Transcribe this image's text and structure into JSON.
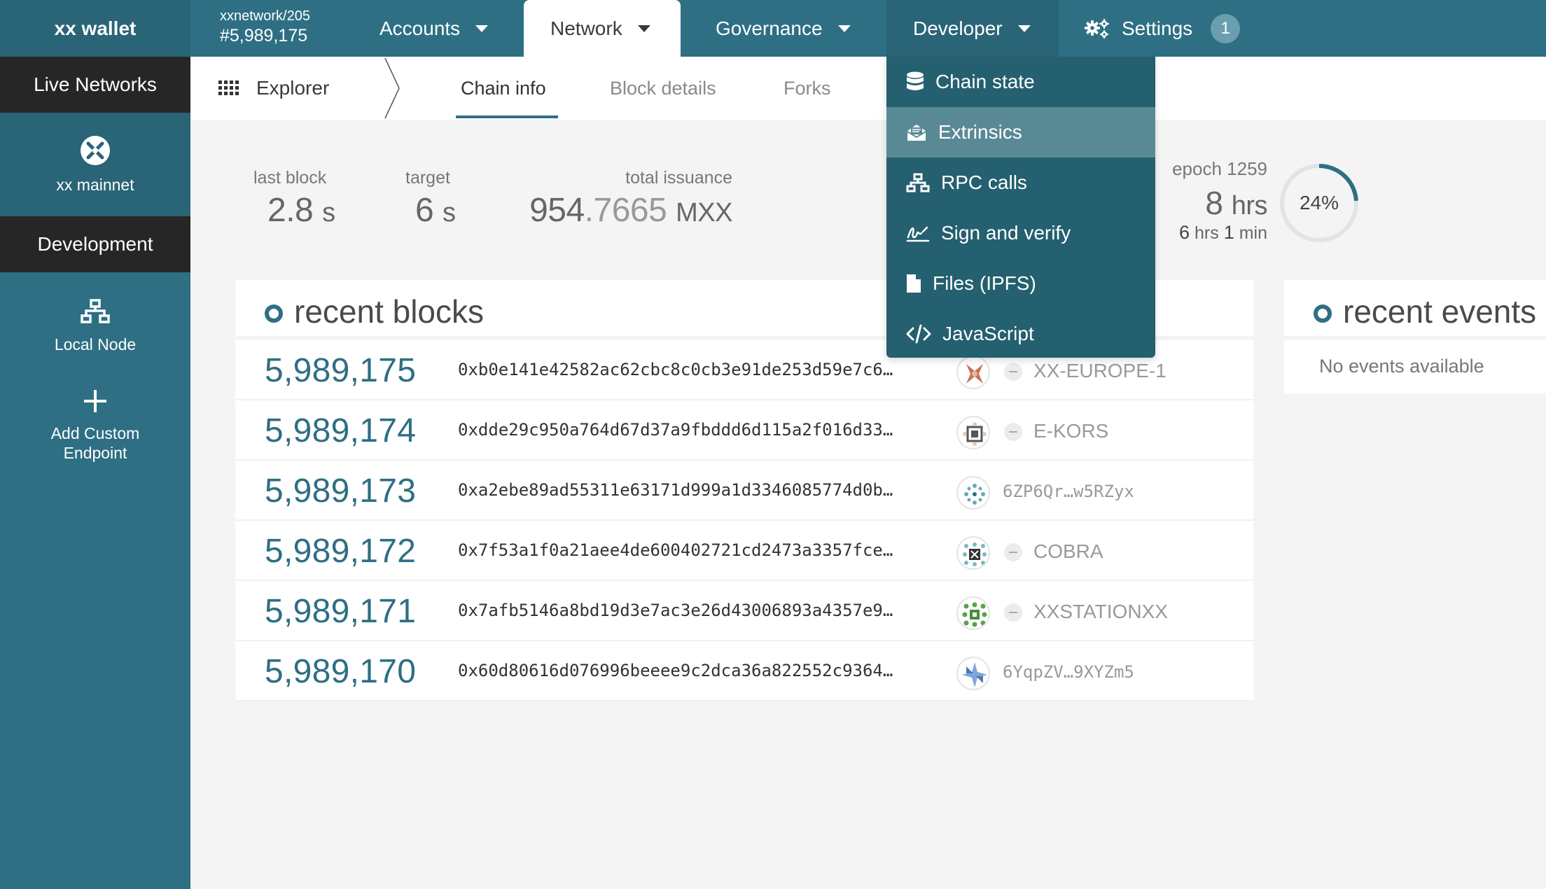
{
  "app": {
    "brand": "xx wallet"
  },
  "chain": {
    "name": "xxnetwork/205",
    "block": "#5,989,175"
  },
  "nav": {
    "accounts": "Accounts",
    "network": "Network",
    "governance": "Governance",
    "developer": "Developer",
    "settings": "Settings",
    "settings_badge": "1"
  },
  "sidebar": {
    "live_networks": "Live Networks",
    "mainnet": "xx mainnet",
    "development": "Development",
    "local_node": "Local Node",
    "add_custom_1": "Add Custom",
    "add_custom_2": "Endpoint"
  },
  "subnav": {
    "explorer": "Explorer",
    "chain_info": "Chain info",
    "block_details": "Block details",
    "forks": "Forks"
  },
  "summary": {
    "last_block_label": "last block",
    "last_block_value": "2.8",
    "last_block_unit": "s",
    "target_label": "target",
    "target_value": "6",
    "target_unit": "s",
    "issuance_label": "total issuance",
    "issuance_int": "954",
    "issuance_dec": ".7665",
    "issuance_unit": "MXX",
    "epoch_label": "epoch 1259",
    "epoch_hours": "8",
    "epoch_hours_unit": "hrs",
    "epoch_remaining_h": "6",
    "epoch_remaining_h_unit": "hrs",
    "epoch_remaining_m": "1",
    "epoch_remaining_m_unit": "min",
    "epoch_percent_label": "24%",
    "epoch_progress": 0.24
  },
  "blocks": {
    "title": "recent blocks",
    "rows": [
      {
        "number": "5,989,175",
        "hash": "0xb0e141e42582ac62cbc8c0cb3e91de253d59e7c6…",
        "author": "XX-EUROPE-1",
        "identity": true
      },
      {
        "number": "5,989,174",
        "hash": "0xdde29c950a764d67d37a9fbddd6d115a2f016d33…",
        "author": "E-KORS",
        "identity": true
      },
      {
        "number": "5,989,173",
        "hash": "0xa2ebe89ad55311e63171d999a1d3346085774d0b…",
        "author": "6ZP6Qr…w5RZyx",
        "identity": false
      },
      {
        "number": "5,989,172",
        "hash": "0x7f53a1f0a21aee4de600402721cd2473a3357fce…",
        "author": "COBRA",
        "identity": true
      },
      {
        "number": "5,989,171",
        "hash": "0x7afb5146a8bd19d3e7ac3e26d43006893a4357e9…",
        "author": "XXSTATIONXX",
        "identity": true
      },
      {
        "number": "5,989,170",
        "hash": "0x60d80616d076996beeee9c2dca36a822552c9364…",
        "author": "6YqpZV…9XYZm5",
        "identity": false
      }
    ]
  },
  "events": {
    "title": "recent events",
    "empty": "No events available"
  },
  "dev_menu": {
    "items": [
      {
        "label": "Chain state",
        "icon": "database-icon"
      },
      {
        "label": "Extrinsics",
        "icon": "envelope-open-icon"
      },
      {
        "label": "RPC calls",
        "icon": "network-icon"
      },
      {
        "label": "Sign and verify",
        "icon": "signature-icon"
      },
      {
        "label": "Files (IPFS)",
        "icon": "file-icon"
      },
      {
        "label": "JavaScript",
        "icon": "code-icon"
      }
    ],
    "active_index": 1
  },
  "colors": {
    "brand": "#2e6f84",
    "brand_dark": "#2a6477",
    "menu_bg": "#24606f",
    "menu_active": "#5a8996"
  }
}
